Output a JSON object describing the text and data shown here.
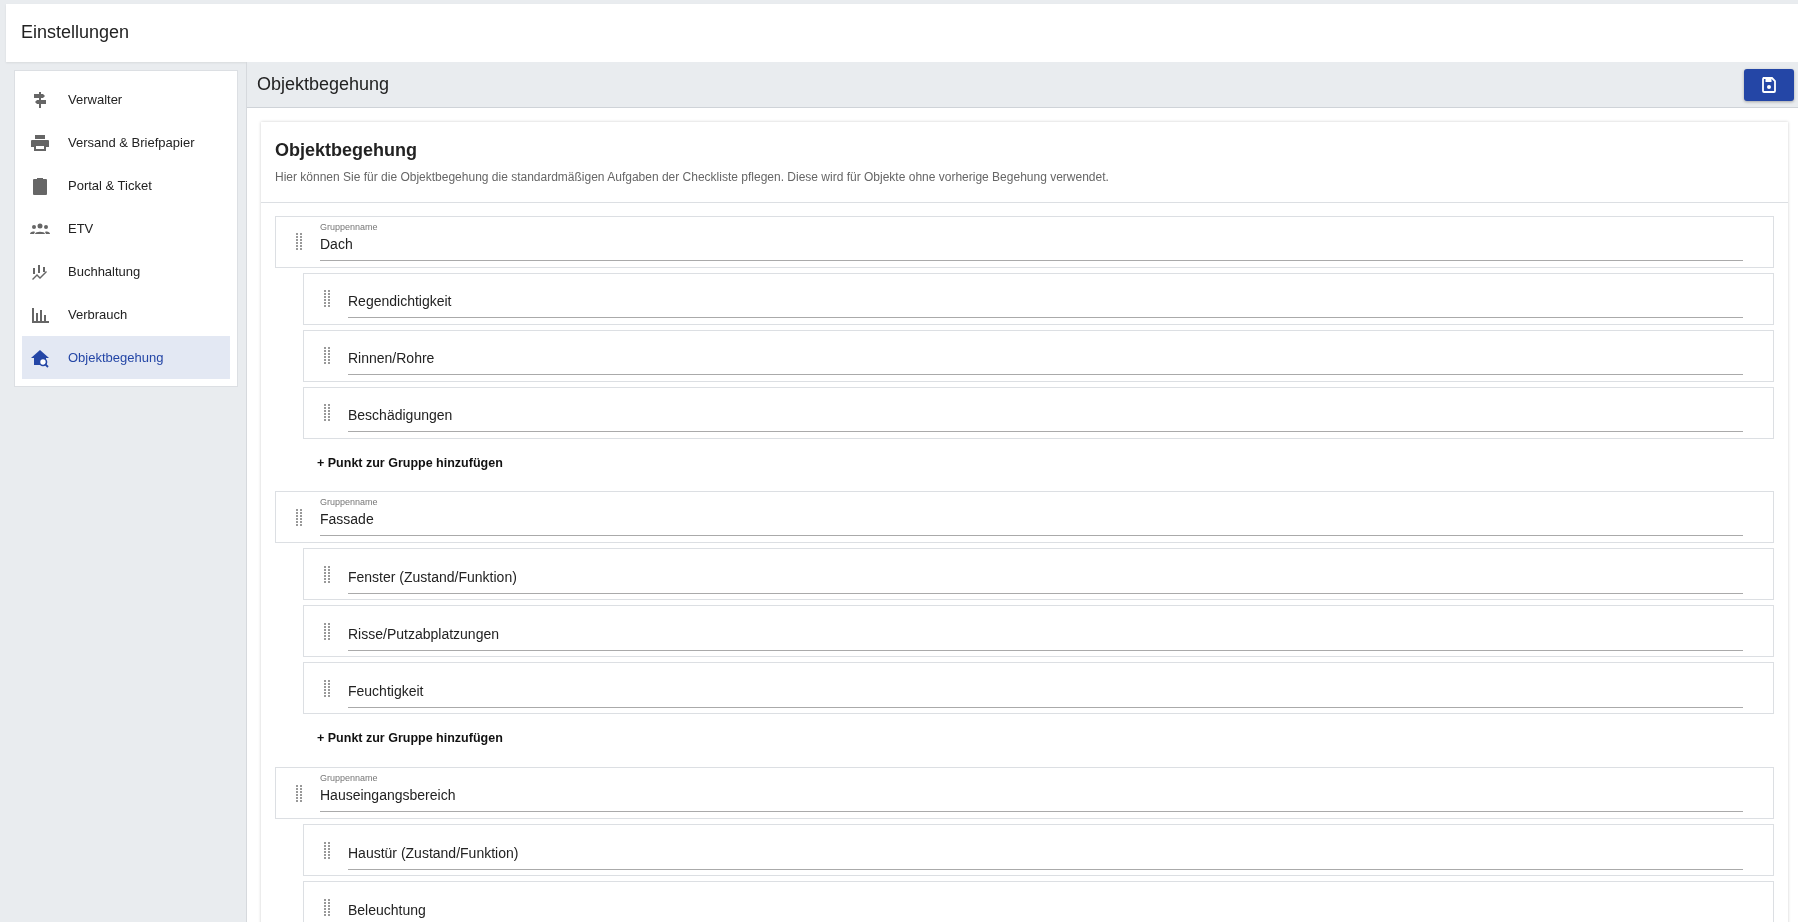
{
  "header": {
    "title": "Einstellungen"
  },
  "sidebar": {
    "items": [
      {
        "label": "Verwalter",
        "selected": false
      },
      {
        "label": "Versand & Briefpapier",
        "selected": false
      },
      {
        "label": "Portal & Ticket",
        "selected": false
      },
      {
        "label": "ETV",
        "selected": false
      },
      {
        "label": "Buchhaltung",
        "selected": false
      },
      {
        "label": "Verbrauch",
        "selected": false
      },
      {
        "label": "Objektbegehung",
        "selected": true
      }
    ]
  },
  "page": {
    "title": "Objektbegehung"
  },
  "card": {
    "title": "Objektbegehung",
    "description": "Hier können Sie für die Objektbegehung die standardmäßigen Aufgaben der Checkliste pflegen. Diese wird für Objekte ohne vorherige Begehung verwendet.",
    "groups": [
      {
        "label": "Gruppenname",
        "value": "Dach",
        "items": [
          "Regendichtigkeit",
          "Rinnen/Rohre",
          "Beschädigungen"
        ],
        "add_link": "+ Punkt zur Gruppe hinzufügen"
      },
      {
        "label": "Gruppenname",
        "value": "Fassade",
        "items": [
          "Fenster (Zustand/Funktion)",
          "Risse/Putzabplatzungen",
          "Feuchtigkeit"
        ],
        "add_link": "+ Punkt zur Gruppe hinzufügen"
      },
      {
        "label": "Gruppenname",
        "value": "Hauseingangsbereich",
        "items": [
          "Haustür (Zustand/Funktion)",
          "Beleuchtung"
        ]
      }
    ]
  }
}
